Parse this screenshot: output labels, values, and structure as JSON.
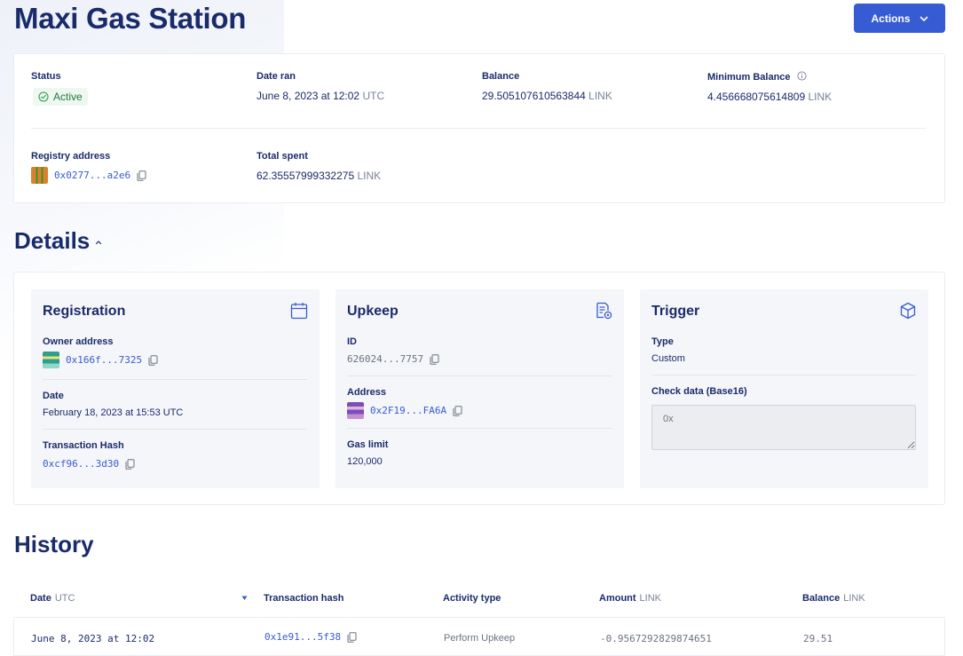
{
  "header": {
    "title": "Maxi Gas Station",
    "actions_label": "Actions"
  },
  "summary": {
    "status_label": "Status",
    "status_value": "Active",
    "date_ran_label": "Date ran",
    "date_ran_value": "June 8, 2023 at 12:02",
    "date_ran_tz": "UTC",
    "balance_label": "Balance",
    "balance_value": "29.505107610563844",
    "balance_unit": "LINK",
    "min_balance_label": "Minimum Balance",
    "min_balance_value": "4.456668075614809",
    "min_balance_unit": "LINK",
    "registry_label": "Registry address",
    "registry_value": "0x0277...a2e6",
    "total_spent_label": "Total spent",
    "total_spent_value": "62.35557999332275",
    "total_spent_unit": "LINK"
  },
  "details": {
    "title": "Details",
    "registration": {
      "title": "Registration",
      "owner_label": "Owner address",
      "owner_value": "0x166f...7325",
      "date_label": "Date",
      "date_value": "February 18, 2023 at 15:53 UTC",
      "tx_label": "Transaction Hash",
      "tx_value": "0xcf96...3d30"
    },
    "upkeep": {
      "title": "Upkeep",
      "id_label": "ID",
      "id_value": "626024...7757",
      "address_label": "Address",
      "address_value": "0x2F19...FA6A",
      "gas_label": "Gas limit",
      "gas_value": "120,000"
    },
    "trigger": {
      "title": "Trigger",
      "type_label": "Type",
      "type_value": "Custom",
      "check_label": "Check data (Base16)",
      "check_placeholder": "0x"
    }
  },
  "history": {
    "title": "History",
    "columns": [
      {
        "label": "Date",
        "unit": "UTC"
      },
      {
        "label": "Transaction hash",
        "unit": ""
      },
      {
        "label": "Activity type",
        "unit": ""
      },
      {
        "label": "Amount",
        "unit": "LINK"
      },
      {
        "label": "Balance",
        "unit": "LINK"
      }
    ],
    "rows": [
      {
        "date": "June 8, 2023 at 12:02",
        "tx": "0x1e91...5f38",
        "activity": "Perform Upkeep",
        "amount": "-0.9567292829874651",
        "balance": "29.51"
      }
    ]
  },
  "colors": {
    "primary": "#375bd2",
    "heading": "#1a2b6b",
    "active_green": "#217a3c"
  }
}
